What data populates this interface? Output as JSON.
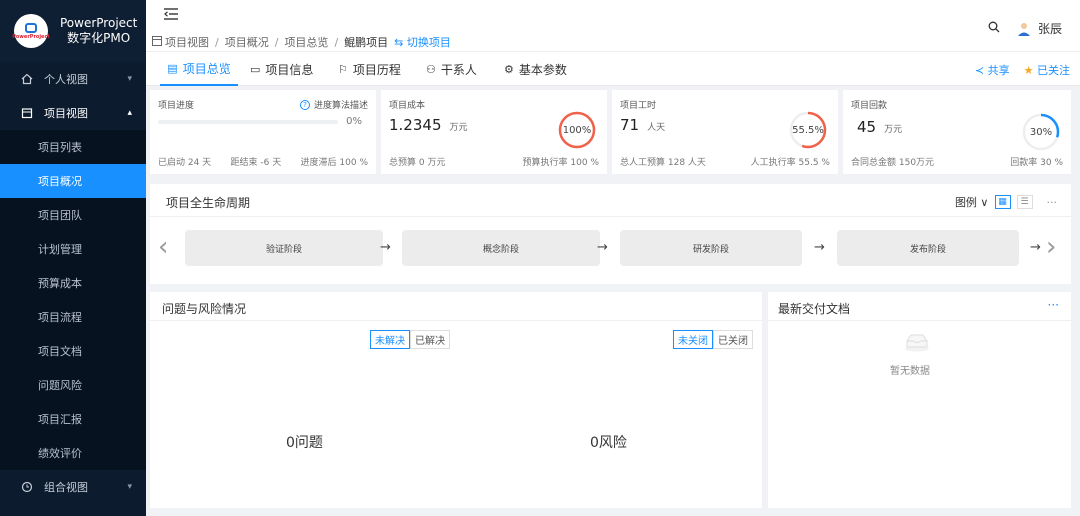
{
  "brand": {
    "line1": "PowerProject",
    "line2": "数字化PMO",
    "logo_text": "PowerProject"
  },
  "sidebar": {
    "groups": [
      {
        "label": "个人视图",
        "icon": "home-icon"
      },
      {
        "label": "项目视图",
        "icon": "calendar-icon"
      },
      {
        "label": "组合视图",
        "icon": "clock-icon"
      }
    ],
    "items": [
      "项目列表",
      "项目概况",
      "项目团队",
      "计划管理",
      "预算成本",
      "项目流程",
      "项目文档",
      "问题风险",
      "项目汇报",
      "绩效评价"
    ],
    "active": "项目概况"
  },
  "header": {
    "breadcrumb": [
      "项目视图",
      "项目概况",
      "项目总览",
      "鲲鹏项目"
    ],
    "switch_label": "切换项目",
    "user": "张辰"
  },
  "tabs": [
    "项目总览",
    "项目信息",
    "项目历程",
    "干系人",
    "基本参数"
  ],
  "tab_actions": {
    "share": "共享",
    "follow": "已关注"
  },
  "kpis": {
    "progress": {
      "label": "项目进度",
      "link": "进度算法描述",
      "percent": "0%",
      "fill": 0,
      "foot": [
        "已启动 24 天",
        "距结束 -6 天",
        "进度滞后 100 %"
      ]
    },
    "cost": {
      "label": "项目成本",
      "value": "1.2345",
      "unit": "万元",
      "ring": "100%",
      "ring_value": 1.0,
      "foot": [
        "总预算 0 万元",
        "预算执行率 100 %"
      ]
    },
    "hours": {
      "label": "项目工时",
      "value": "71",
      "unit": "人天",
      "ring": "55.5%",
      "ring_value": 0.555,
      "foot": [
        "总人工预算 128 人天",
        "人工执行率 55.5 %"
      ]
    },
    "payment": {
      "label": "项目回款",
      "value": "45",
      "unit": "万元",
      "ring": "30%",
      "ring_value": 0.3,
      "foot": [
        "合同总金额 150万元",
        "回款率 30 %"
      ]
    }
  },
  "lifecycle": {
    "title": "项目全生命周期",
    "legend": "图例",
    "stages": [
      "验证阶段",
      "概念阶段",
      "研发阶段",
      "发布阶段"
    ]
  },
  "issues": {
    "title": "问题与风险情况",
    "issue_tabs": [
      "未解决",
      "已解决"
    ],
    "risk_tabs": [
      "未关闭",
      "已关闭"
    ],
    "issue_count": "0问题",
    "risk_count": "0风险"
  },
  "docs": {
    "title": "最新交付文档",
    "more": "···",
    "empty": "暂无数据"
  },
  "colors": {
    "accent": "#1890ff",
    "ring_red": "#f0614a",
    "ring_blue": "#1890ff",
    "sidebar": "#0d1b2e"
  }
}
